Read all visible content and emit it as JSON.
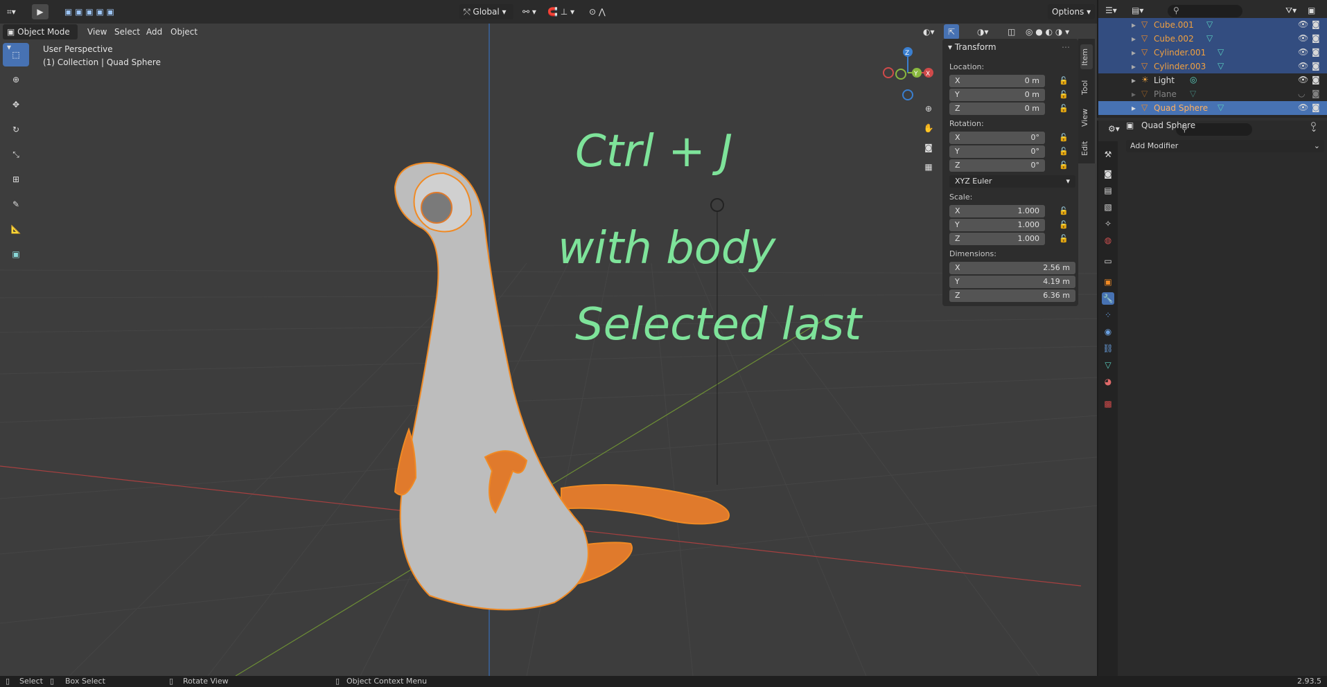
{
  "header": {
    "editor_type_icon": "editor-type-icon",
    "orientation_label": "Global",
    "options_label": "Options"
  },
  "viewport_header": {
    "mode_label": "Object Mode",
    "menu": [
      "View",
      "Select",
      "Add",
      "Object"
    ]
  },
  "viewport": {
    "view_name": "User Perspective",
    "collection_info": "(1) Collection | Quad Sphere",
    "handwriting": [
      "Ctrl + J",
      "with body",
      "Selected last"
    ],
    "gizmo_axes": [
      "X",
      "Y",
      "Z"
    ],
    "colors": {
      "x_axis": "#d04a4a",
      "y_axis": "#8ab83f",
      "z_axis": "#3a7fd0",
      "selection": "#f08a24",
      "annotation": "#7ee39a"
    }
  },
  "npanel": {
    "section_title": "Transform",
    "location_label": "Location:",
    "location": [
      {
        "axis": "X",
        "value": "0 m"
      },
      {
        "axis": "Y",
        "value": "0 m"
      },
      {
        "axis": "Z",
        "value": "0 m"
      }
    ],
    "rotation_label": "Rotation:",
    "rotation": [
      {
        "axis": "X",
        "value": "0°"
      },
      {
        "axis": "Y",
        "value": "0°"
      },
      {
        "axis": "Z",
        "value": "0°"
      }
    ],
    "rotation_mode": "XYZ Euler",
    "scale_label": "Scale:",
    "scale": [
      {
        "axis": "X",
        "value": "1.000"
      },
      {
        "axis": "Y",
        "value": "1.000"
      },
      {
        "axis": "Z",
        "value": "1.000"
      }
    ],
    "dimensions_label": "Dimensions:",
    "dimensions": [
      {
        "axis": "X",
        "value": "2.56 m"
      },
      {
        "axis": "Y",
        "value": "4.19 m"
      },
      {
        "axis": "Z",
        "value": "6.36 m"
      }
    ],
    "tabs": [
      "Item",
      "Tool",
      "View",
      "Edit"
    ]
  },
  "outliner": {
    "items": [
      {
        "name": "Cube.001",
        "type": "mesh",
        "state": "selected"
      },
      {
        "name": "Cube.002",
        "type": "mesh",
        "state": "selected"
      },
      {
        "name": "Cylinder.001",
        "type": "mesh",
        "state": "selected"
      },
      {
        "name": "Cylinder.003",
        "type": "mesh",
        "state": "selected"
      },
      {
        "name": "Light",
        "type": "light",
        "state": "normal"
      },
      {
        "name": "Plane",
        "type": "mesh",
        "state": "hidden"
      },
      {
        "name": "Quad Sphere",
        "type": "mesh",
        "state": "active"
      }
    ]
  },
  "properties": {
    "object_name": "Quad Sphere",
    "add_modifier_label": "Add Modifier"
  },
  "statusbar": {
    "select": "Select",
    "box_select": "Box Select",
    "rotate_view": "Rotate View",
    "context_menu": "Object Context Menu",
    "version": "2.93.5"
  }
}
